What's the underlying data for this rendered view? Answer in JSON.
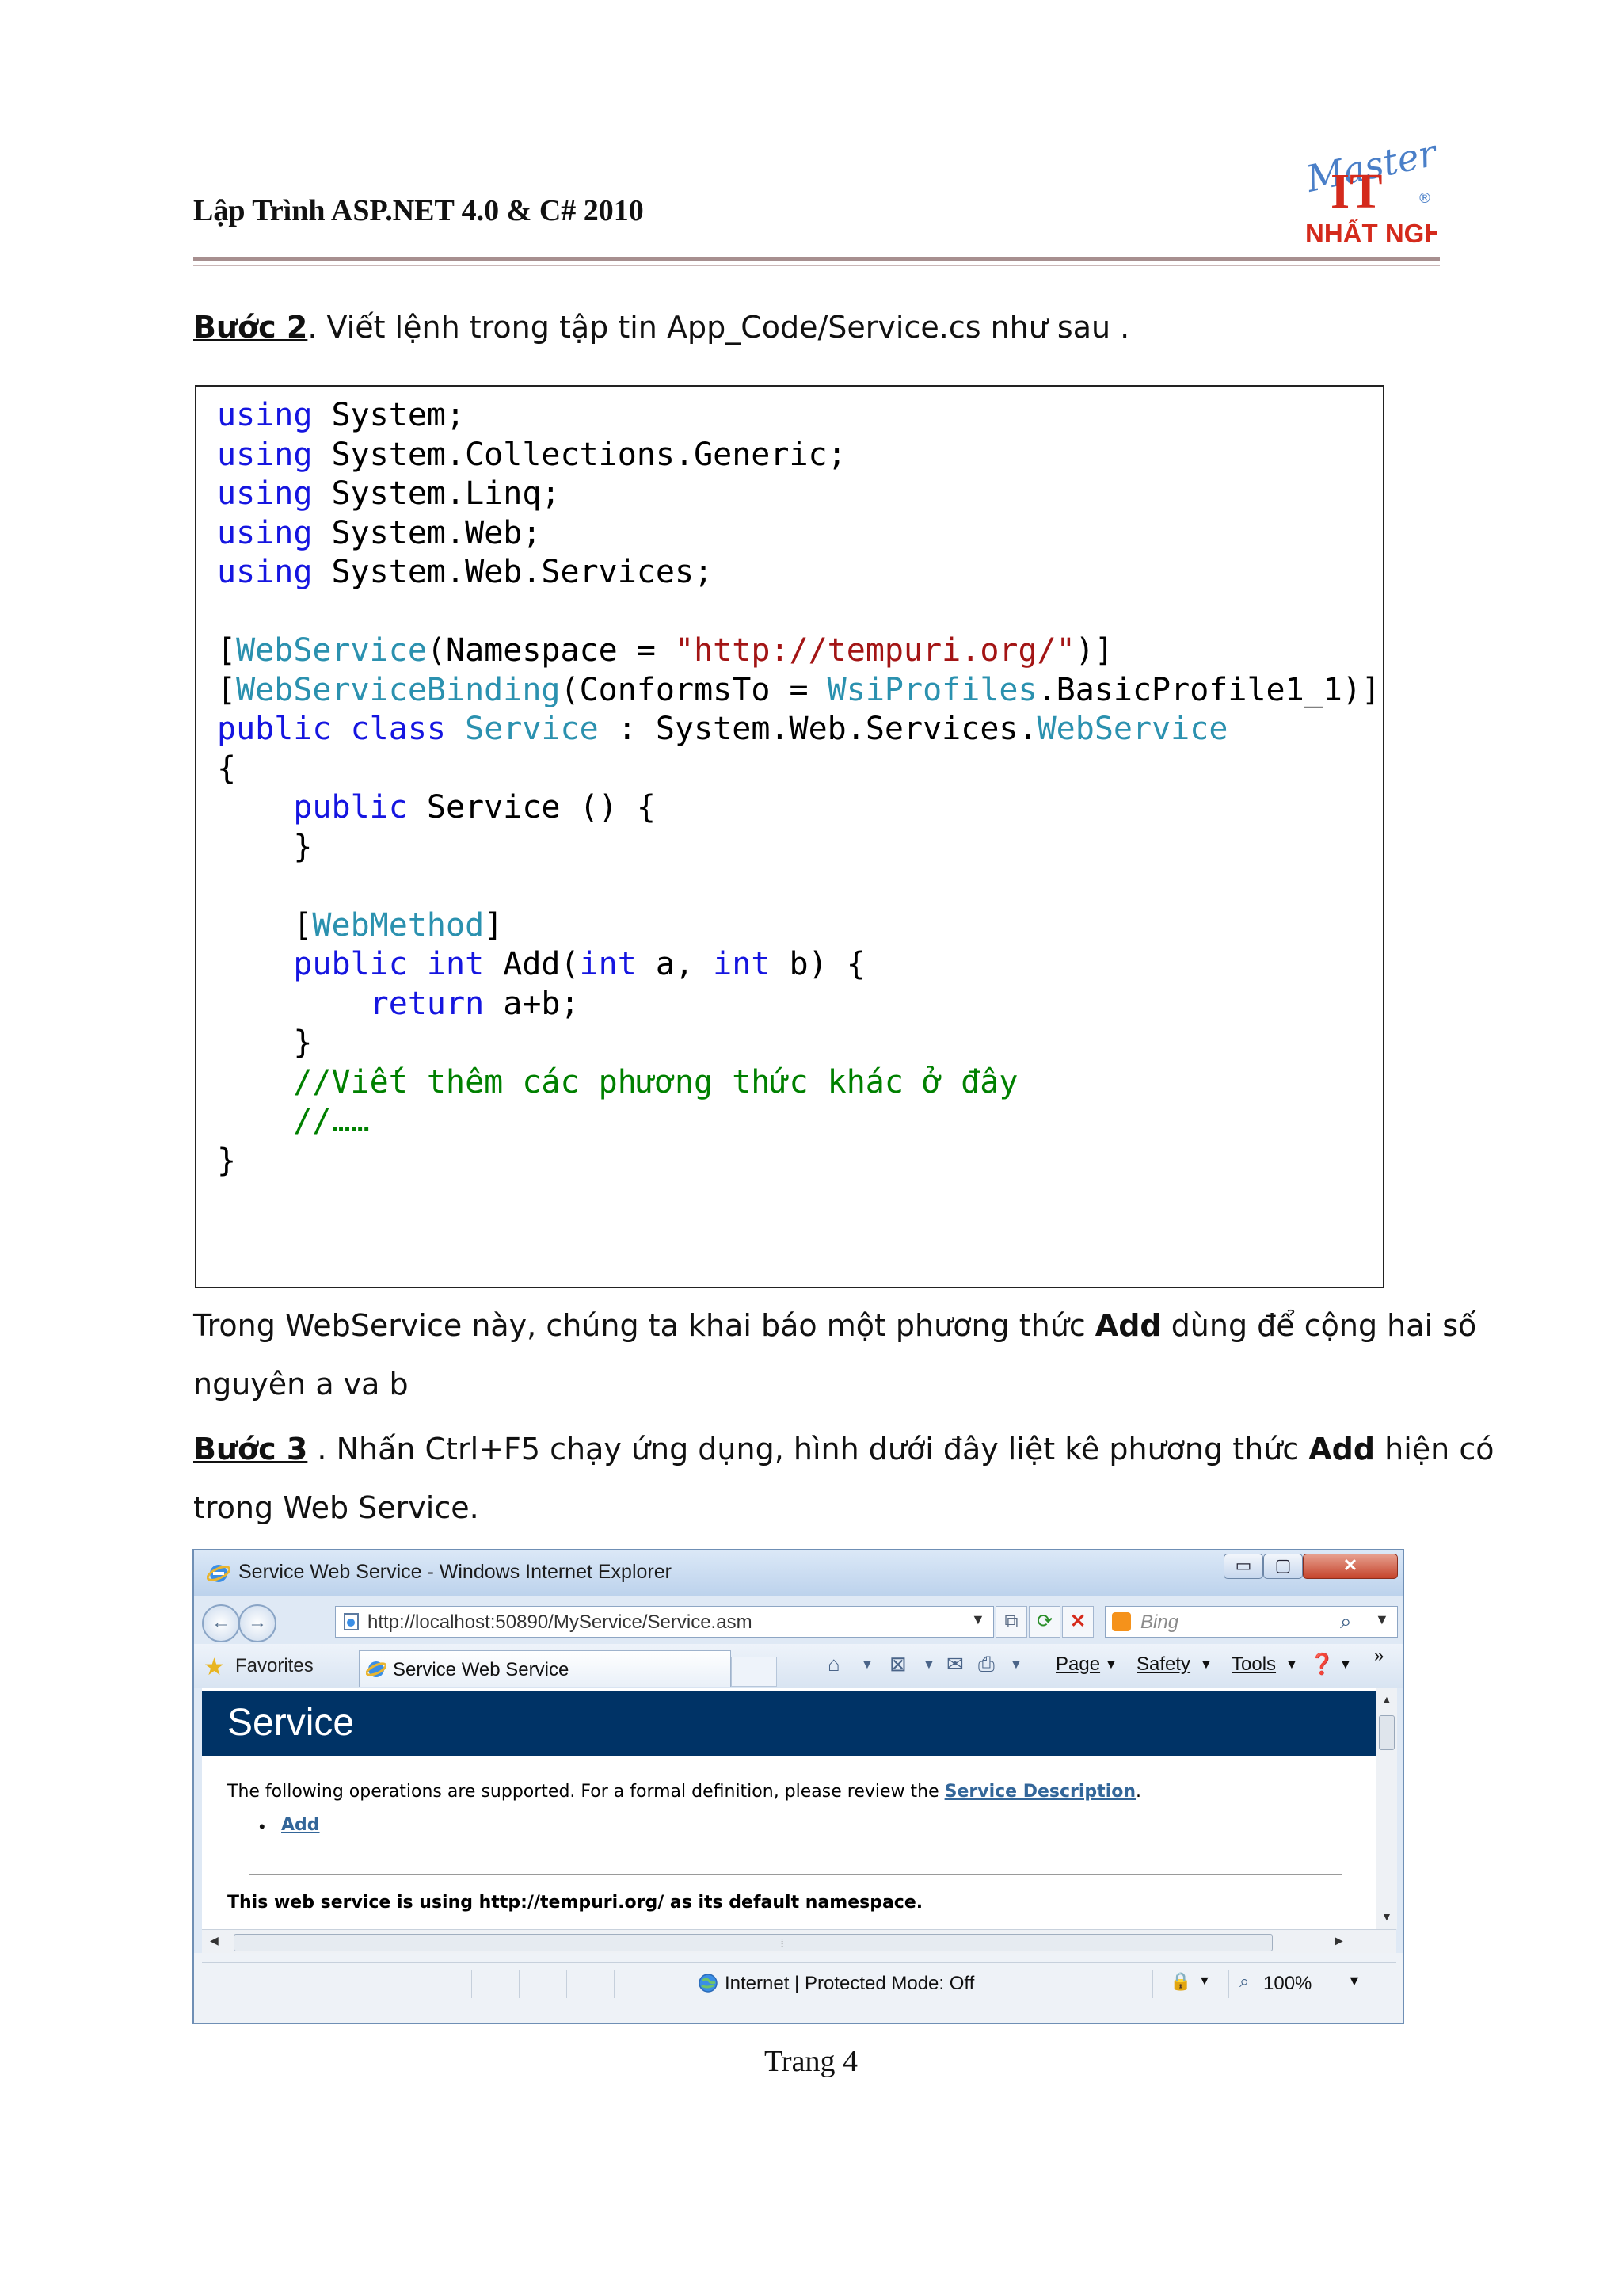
{
  "header": {
    "title": "Lập Trình ASP.NET 4.0 & C# 2010",
    "logo": {
      "script_text": "Master",
      "letters": "IT",
      "registered": "®",
      "brand": "NHẤT NGHỆ"
    }
  },
  "step2": {
    "label": "Bước 2",
    "text": ". Viết lệnh trong tập tin App_Code/Service.cs như sau ."
  },
  "code": {
    "using": "using",
    "ns1": " System;",
    "ns2": " System.Collections.Generic;",
    "ns3": " System.Linq;",
    "ns4": " System.Web;",
    "ns5": " System.Web.Services;",
    "attr_webservice": "WebService",
    "attr_ws_arg": "(Namespace = ",
    "attr_ws_url": "\"http://tempuri.org/\"",
    "attr_ws_end": ")]",
    "attr_binding": "WebServiceBinding",
    "attr_binding_arg": "(ConformsTo = ",
    "wsiprofiles": "WsiProfiles",
    "basic_profile": ".BasicProfile1_1)]",
    "kw_public": "public",
    "kw_class": "class",
    "class_name": "Service",
    "base_prefix": " : System.Web.Services.",
    "base_type": "WebService",
    "open_brace": "{",
    "close_brace": "}",
    "ctor": " Service () {",
    "attr_webmethod": "WebMethod",
    "kw_int": "int",
    "add_sig1": " Add(",
    "add_sig2": " a, ",
    "add_sig3": " b) {",
    "kw_return": "return",
    "return_expr": " a+b;",
    "comment1": "//Viết thêm các phương thức khác ở đây",
    "comment2": "//……"
  },
  "paragraph1": {
    "text_before": "Trong  WebService này, chúng ta khai báo một phương thức ",
    "bold": "Add",
    "text_after": " dùng để cộng hai số",
    "line2": "nguyên a va b"
  },
  "step3": {
    "label": "Bước 3",
    "text_before": " . Nhấn Ctrl+F5 chạy ứng dụng, hình dưới đây liệt kê phương thức ",
    "bold": "Add",
    "text_after": " hiện có",
    "line2": "trong Web Service."
  },
  "browser": {
    "window_title": "Service Web Service - Windows Internet Explorer",
    "address": "http://localhost:50890/MyService/Service.asm",
    "search_placeholder": "Bing",
    "favorites_label": "Favorites",
    "tab_label": "Service Web Service",
    "menu": {
      "page": "Page",
      "safety": "Safety",
      "tools": "Tools"
    },
    "chevron": "»",
    "content": {
      "heading": "Service",
      "intro_before": "The following operations are supported. For a formal definition, please review the ",
      "service_description_link": "Service Description",
      "intro_after": ".",
      "operations": [
        "Add"
      ],
      "namespace_note": "This web service is using http://tempuri.org/ as its default namespace."
    },
    "status": {
      "zone": "Internet | Protected Mode: Off",
      "zoom": "100%"
    },
    "icons": [
      "ie-icon",
      "back-arrow-icon",
      "forward-arrow-icon",
      "refresh-icon",
      "stop-icon",
      "search-icon",
      "favorites-star-icon",
      "home-icon",
      "rss-icon",
      "mail-icon",
      "print-icon",
      "help-icon",
      "globe-icon",
      "lock-icon",
      "zoom-icon"
    ]
  },
  "footer": {
    "page_number": "Trang 4"
  },
  "colors": {
    "keyword": "#1515e0",
    "type": "#2b91af",
    "string": "#a31515",
    "comment": "#008000",
    "service_banner": "#003366",
    "link": "#336699"
  }
}
